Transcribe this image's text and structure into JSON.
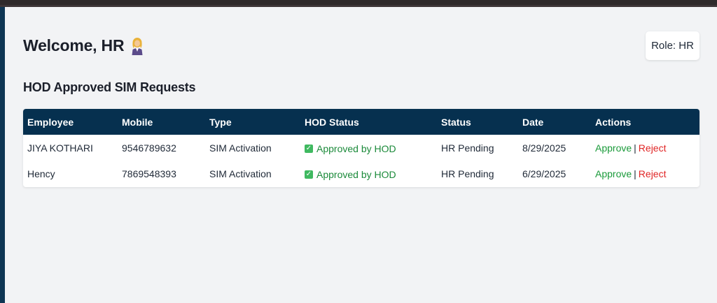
{
  "header": {
    "welcome": "Welcome, HR",
    "role_badge": "Role: HR"
  },
  "section": {
    "title": "HOD Approved SIM Requests"
  },
  "table": {
    "columns": [
      "Employee",
      "Mobile",
      "Type",
      "HOD Status",
      "Status",
      "Date",
      "Actions"
    ],
    "rows": [
      {
        "employee": "JIYA KOTHARI",
        "mobile": "9546789632",
        "type": "SIM Activation",
        "hod_status": "Approved by HOD",
        "status": "HR Pending",
        "date": "8/29/2025",
        "approve": "Approve",
        "separator": "|",
        "reject": "Reject"
      },
      {
        "employee": "Hency",
        "mobile": "7869548393",
        "type": "SIM Activation",
        "hod_status": "Approved by HOD",
        "status": "HR Pending",
        "date": "6/29/2025",
        "approve": "Approve",
        "separator": "|",
        "reject": "Reject"
      }
    ]
  },
  "colors": {
    "header_bg": "#06304f",
    "approve": "#1a9a3a",
    "reject": "#e02424",
    "hod_ok": "#1b8a3a"
  },
  "icons": {
    "welcome": "woman-office-worker-emoji",
    "hod_status": "check-mark-button-icon"
  }
}
